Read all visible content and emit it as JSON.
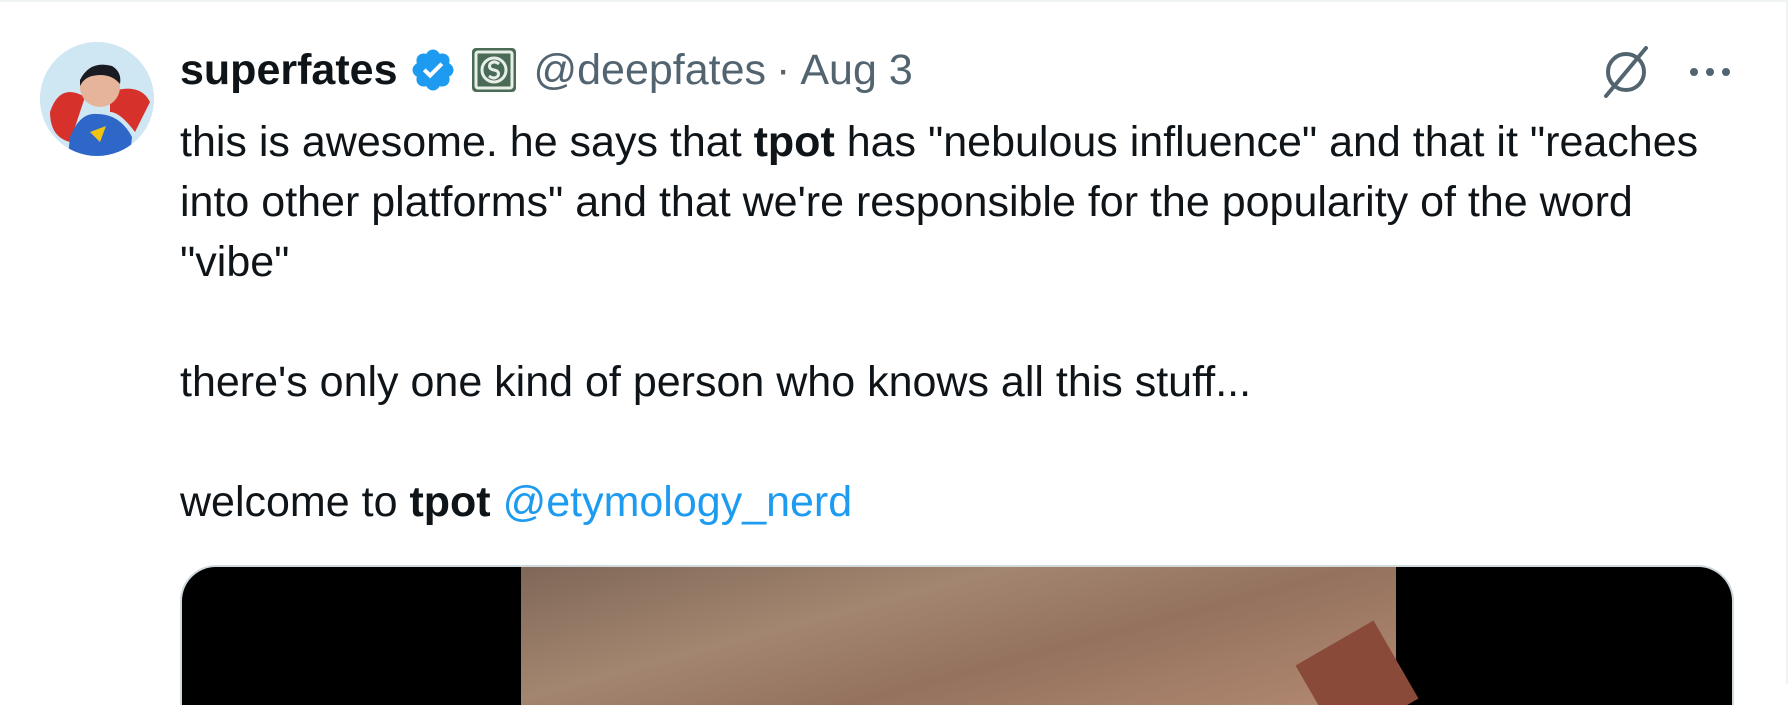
{
  "tweet": {
    "author": {
      "display_name": "superfates",
      "handle": "@deepfates",
      "verified": true,
      "affiliate_icon": "dollar-badge-icon"
    },
    "separator": "·",
    "date": "Aug 3",
    "body": {
      "line1_prefix": "this is awesome. he says that ",
      "line1_bold": "tpot",
      "line1_suffix": " has \"nebulous influence\" and that it \"reaches into other platforms\" and that we're responsible for the popularity of the word \"vibe\"",
      "line2": "there's only one kind of person who knows all this stuff...",
      "line3_prefix": "welcome to ",
      "line3_bold": "tpot",
      "line3_mention": "@etymology_nerd"
    },
    "actions": {
      "grok_icon": "grok-icon",
      "more_icon": "more-icon"
    }
  },
  "colors": {
    "text": "#0f1419",
    "secondary": "#536471",
    "link": "#1d9bf0",
    "verified": "#1d9bf0",
    "border": "#cfd9de"
  }
}
